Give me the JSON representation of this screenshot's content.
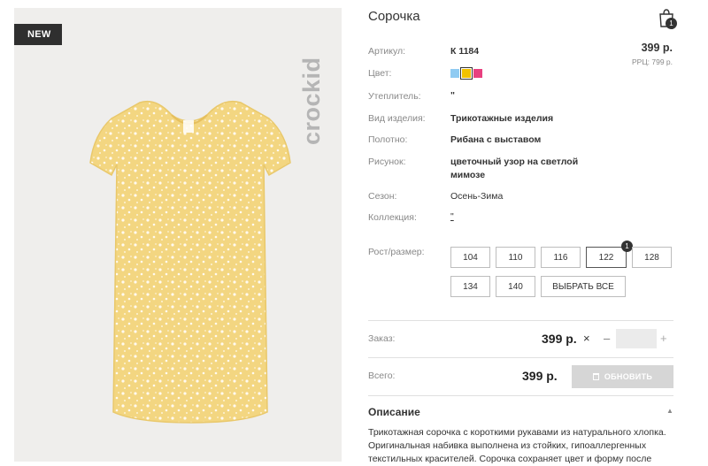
{
  "product": {
    "badge": "NEW",
    "brand_logo": "crockid",
    "title": "Сорочка",
    "cart_count": "1",
    "price": "399 р.",
    "rrp": "РРЦ: 799 р."
  },
  "specs": {
    "article_label": "Артикул:",
    "article_value": "К 1184",
    "color_label": "Цвет:",
    "insulation_label": "Утеплитель:",
    "insulation_value": "\"",
    "type_label": "Вид изделия:",
    "type_value": "Трикотажные изделия",
    "fabric_label": "Полотно:",
    "fabric_value": "Рибана с выставом",
    "pattern_label": "Рисунок:",
    "pattern_value": "цветочный узор на светлой мимозе",
    "season_label": "Сезон:",
    "season_value": "Осень-Зима",
    "collection_label": "Коллекция:",
    "collection_value": "\"",
    "size_label": "Рост/размер:"
  },
  "colors": [
    "#8fcbf2",
    "#f2c200",
    "#e8407f"
  ],
  "sizes": {
    "items": [
      "104",
      "110",
      "116",
      "122",
      "128",
      "134",
      "140"
    ],
    "selected": "122",
    "selected_count": "1",
    "select_all": "ВЫБРАТЬ ВСЕ"
  },
  "order": {
    "order_label": "Заказ:",
    "order_price": "399 р.",
    "remove_symbol": "×",
    "minus": "–",
    "plus": "+",
    "total_label": "Всего:",
    "total_price": "399 р.",
    "update_button": "ОБНОВИТЬ"
  },
  "description": {
    "title": "Описание",
    "text": "Трикотажная сорочка с короткими рукавами из натурального хлопка. Оригинальная набивка выполнена из стойких, гипоаллергенных текстильных красителей. Сорочка сохраняет цвет и форму после"
  }
}
